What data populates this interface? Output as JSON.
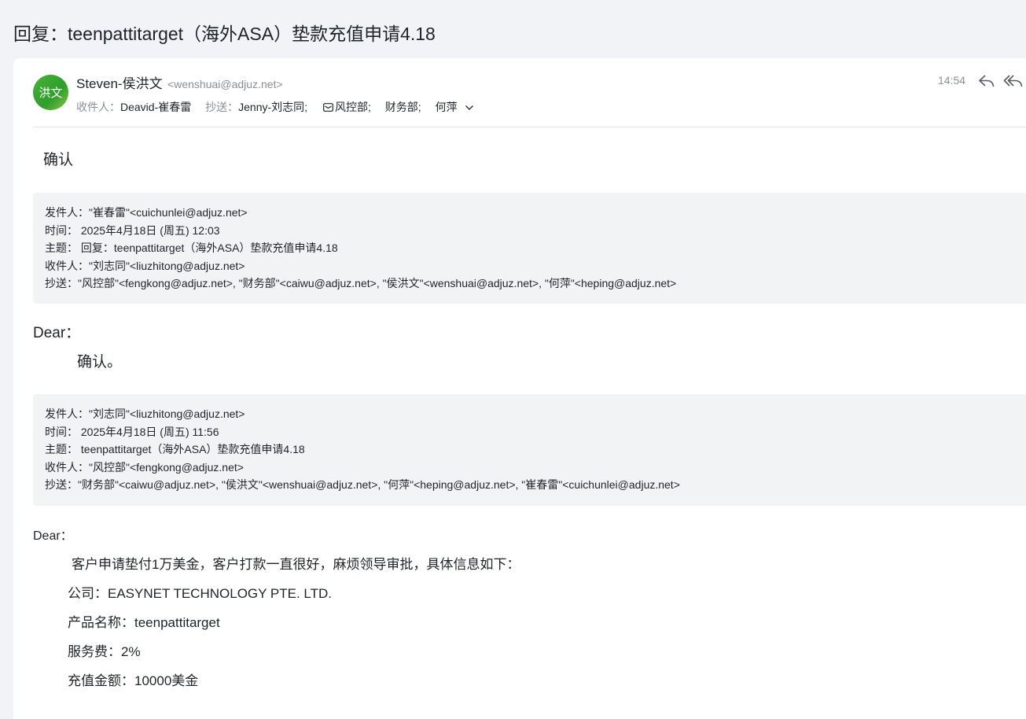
{
  "subject": "回复：teenpattitarget（海外ASA）垫款充值申请4.18",
  "sender": {
    "avatar_text": "洪文",
    "name": "Steven-侯洪文",
    "email": "<wenshuai@adjuz.net>"
  },
  "recipients": {
    "to_label": "收件人：",
    "to": "Deavid-崔春雷",
    "cc_label": "抄送：",
    "cc": [
      "Jenny-刘志同;",
      "风控部;",
      "财务部;",
      "何萍"
    ]
  },
  "time": "14:54",
  "icons": {
    "reply": "reply-icon",
    "reply_all": "reply-all-icon",
    "group": "group-mail-icon",
    "chevron": "chevron-down-icon"
  },
  "top_reply": "确认",
  "quote1": {
    "from": "发件人：\"崔春雷\"<cuichunlei@adjuz.net>",
    "time": "时间： 2025年4月18日 (周五) 12:03",
    "subject": "主题： 回复：teenpattitarget（海外ASA）垫款充值申请4.18",
    "to": "收件人：\"刘志同\"<liuzhitong@adjuz.net>",
    "cc": "抄送：\"风控部\"<fengkong@adjuz.net>, \"财务部\"<caiwu@adjuz.net>, \"侯洪文\"<wenshuai@adjuz.net>, \"何萍\"<heping@adjuz.net>"
  },
  "reply1": {
    "greeting": "Dear：",
    "text": "确认。"
  },
  "quote2": {
    "from": "发件人：\"刘志同\"<liuzhitong@adjuz.net>",
    "time": "时间： 2025年4月18日 (周五) 11:56",
    "subject": "主题： teenpattitarget（海外ASA）垫款充值申请4.18",
    "to": "收件人：\"风控部\"<fengkong@adjuz.net>",
    "cc": "抄送：\"财务部\"<caiwu@adjuz.net>, \"侯洪文\"<wenshuai@adjuz.net>, \"何萍\"<heping@adjuz.net>, \"崔春雷\"<cuichunlei@adjuz.net>"
  },
  "original": {
    "greeting": "Dear：",
    "intro": "客户申请垫付1万美金，客户打款一直很好，麻烦领导审批，具体信息如下：",
    "company": "公司：EASYNET TECHNOLOGY PTE. LTD.",
    "product": "产品名称：teenpattitarget",
    "fee": "服务费：2%",
    "amount": "充值金额：10000美金"
  }
}
